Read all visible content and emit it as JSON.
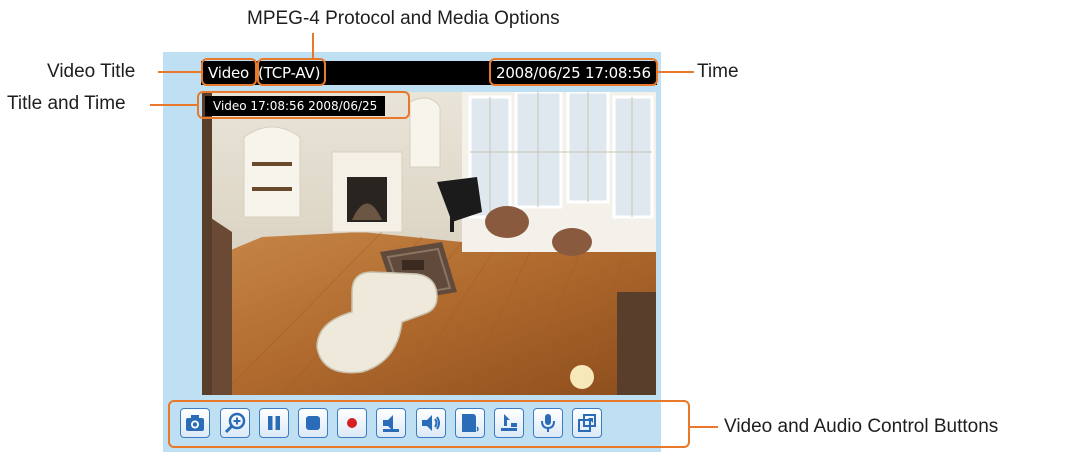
{
  "annotations": {
    "mpeg4": "MPEG-4 Protocol and Media Options",
    "video_title": "Video Title",
    "title_and_time": "Title and Time",
    "time": "Time",
    "controls": "Video and Audio Control Buttons"
  },
  "viewer": {
    "title": "Video",
    "protocol": "(TCP-AV)",
    "datetime": "2008/06/25 17:08:56",
    "overlay_text": "Video 17:08:56  2008/06/25"
  },
  "controls": {
    "buttons": [
      "snapshot",
      "digital-zoom",
      "pause",
      "stop",
      "record",
      "volume",
      "mute",
      "talk",
      "speaker-volume",
      "microphone",
      "fullscreen"
    ]
  },
  "colors": {
    "annotation_accent": "#e8782a",
    "panel_bg": "#bfe0f2",
    "button_blue": "#2b6cb8",
    "record_red": "#d42020"
  }
}
